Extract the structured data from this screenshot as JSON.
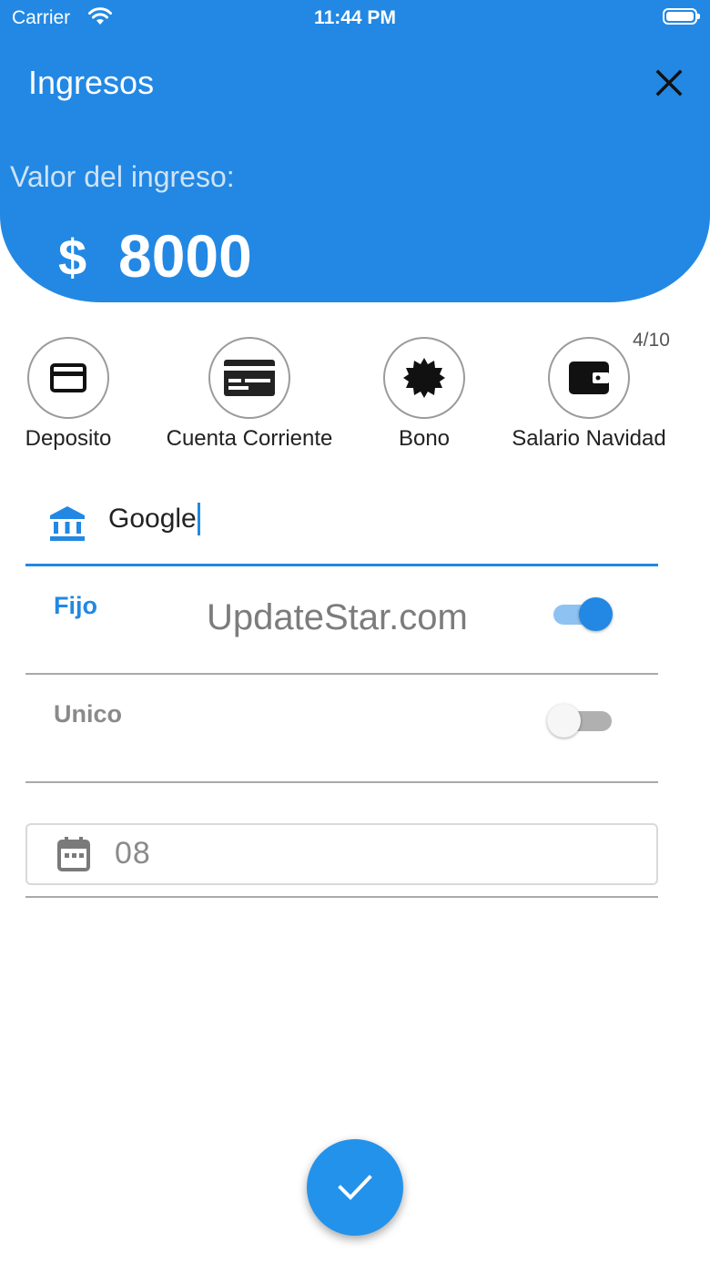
{
  "status_bar": {
    "carrier": "Carrier",
    "time": "11:44 PM"
  },
  "header": {
    "title": "Ingresos",
    "value_label": "Valor del ingreso:",
    "currency": "$",
    "amount": "8000"
  },
  "categories": {
    "counter": "4/10",
    "items": [
      {
        "label": "Deposito",
        "icon": "credit-card-icon"
      },
      {
        "label": "Cuenta Corriente",
        "icon": "card-outline-icon"
      },
      {
        "label": "Bono",
        "icon": "badge-burst-icon"
      },
      {
        "label": "Salario Navidad",
        "icon": "wallet-icon"
      }
    ]
  },
  "bank_field": {
    "value": "Google",
    "icon": "bank-icon"
  },
  "options": {
    "fijo": {
      "label": "Fijo",
      "on": true
    },
    "unico": {
      "label": "Unico",
      "on": false
    }
  },
  "watermark": "UpdateStar.com",
  "date_field": {
    "value": "08",
    "icon": "calendar-icon"
  },
  "colors": {
    "primary": "#2288e3",
    "switch_on_track": "#8ec2f2",
    "switch_off_track": "#b0b0b0",
    "switch_off_knob": "#f6f6f6"
  }
}
